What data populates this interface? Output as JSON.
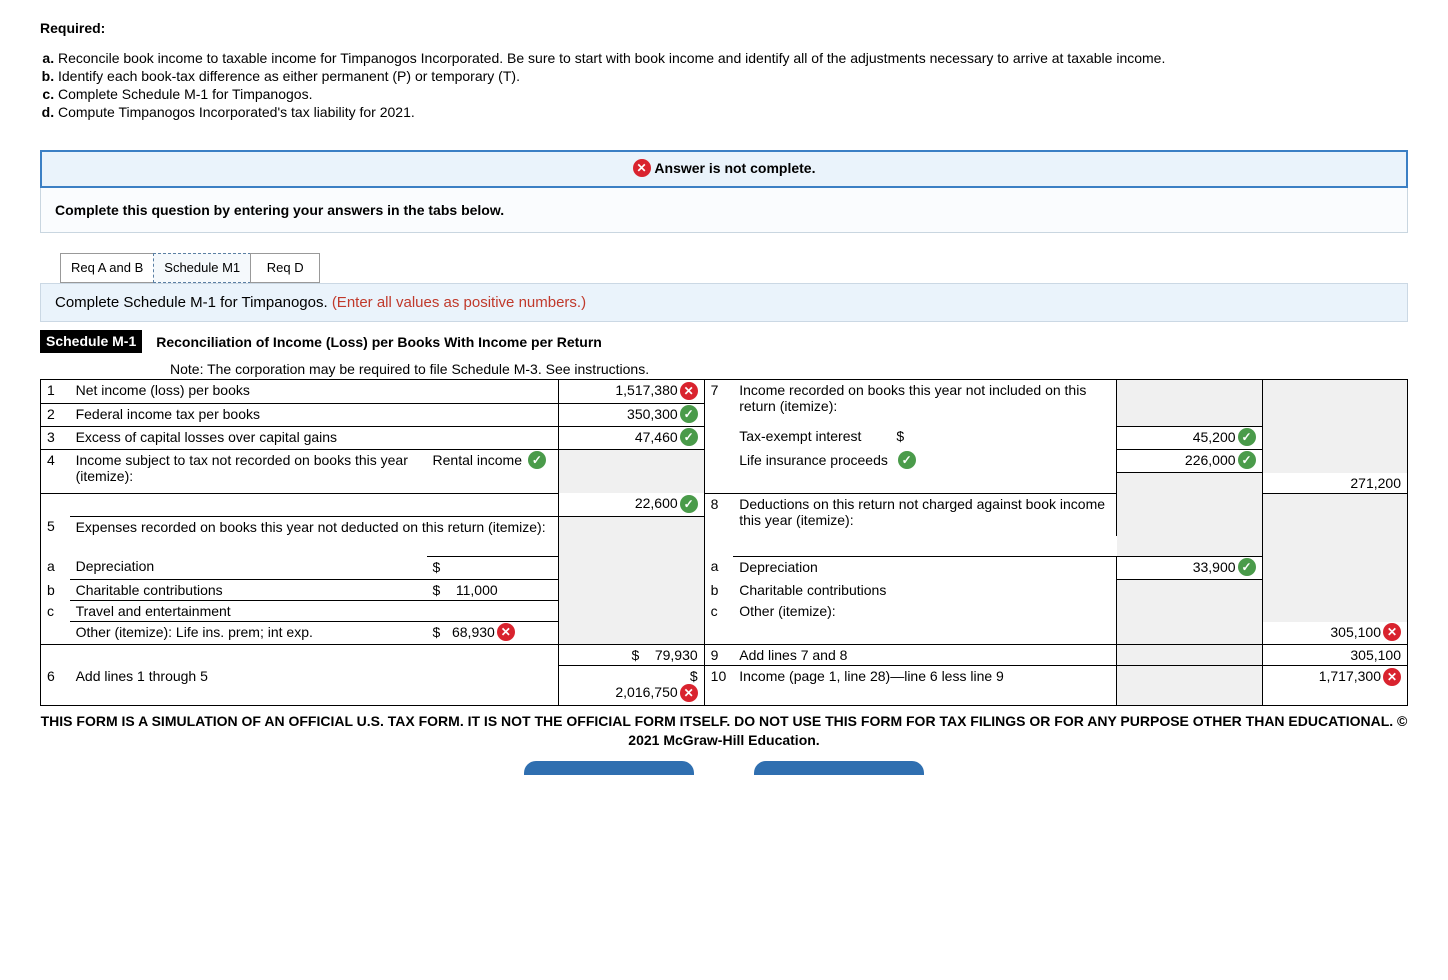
{
  "heading": "Required:",
  "requirements": [
    "Reconcile book income to taxable income for Timpanogos Incorporated. Be sure to start with book income and identify all of the adjustments necessary to arrive at taxable income.",
    "Identify each book-tax difference as either permanent (P) or temporary (T).",
    "Complete Schedule M-1 for Timpanogos.",
    "Compute Timpanogos Incorporated's tax liability for 2021."
  ],
  "alert": "Answer is not complete.",
  "sub_alert": "Complete this question by entering your answers in the tabs below.",
  "tabs": {
    "a": "Req A and B",
    "b": "Schedule M1",
    "c": "Req D"
  },
  "instruction": "Complete Schedule M-1 for Timpanogos. ",
  "instruction_hint": "(Enter all values as positive numbers.)",
  "m1": {
    "badge": "Schedule M-1",
    "title": "Reconciliation of Income (Loss) per Books With Income per Return",
    "note": "Note:  The corporation may be required to file Schedule M-3. See instructions.",
    "left": {
      "l1": "Net income (loss) per books",
      "l2": "Federal income tax per books",
      "l3": "Excess of capital losses over capital gains",
      "l4": "Income subject to tax not recorded on books this year (itemize):",
      "l4sub": "Rental income",
      "l5": "Expenses recorded on books this year not deducted on this return (itemize):",
      "l5a": "Depreciation",
      "l5b": "Charitable contributions",
      "l5c": "Travel and entertainment",
      "l5other": "Other (itemize): Life ins. prem; int exp.",
      "l6": "Add lines 1 through 5"
    },
    "right": {
      "l7": "Income recorded on books this year not included on this return (itemize):",
      "l7a": "Tax-exempt interest",
      "l7b": "Life insurance proceeds",
      "l8": "Deductions on this return not charged against book income this year (itemize):",
      "l8a": "Depreciation",
      "l8b": "Charitable contributions",
      "l8c": "Other (itemize):",
      "l9": "Add lines 7 and 8",
      "l10": "Income (page 1, line 28)—line 6 less line 9"
    },
    "values": {
      "v1": "1,517,380",
      "v2": "350,300",
      "v3": "47,460",
      "v4_sub": "22,600",
      "v5b": "11,000",
      "v5other": "68,930",
      "v5total": "79,930",
      "v6": "2,016,750",
      "v7a": "45,200",
      "v7b": "226,000",
      "v7total": "271,200",
      "v8a": "33,900",
      "v8total": "305,100",
      "v9": "305,100",
      "v10": "1,717,300"
    }
  },
  "disclaimer": "THIS FORM IS A SIMULATION OF AN OFFICIAL U.S. TAX FORM. IT IS NOT THE OFFICIAL FORM ITSELF. DO NOT USE THIS FORM FOR TAX FILINGS OR FOR ANY PURPOSE OTHER THAN EDUCATIONAL. © 2021 McGraw-Hill Education.",
  "dollar": "$"
}
